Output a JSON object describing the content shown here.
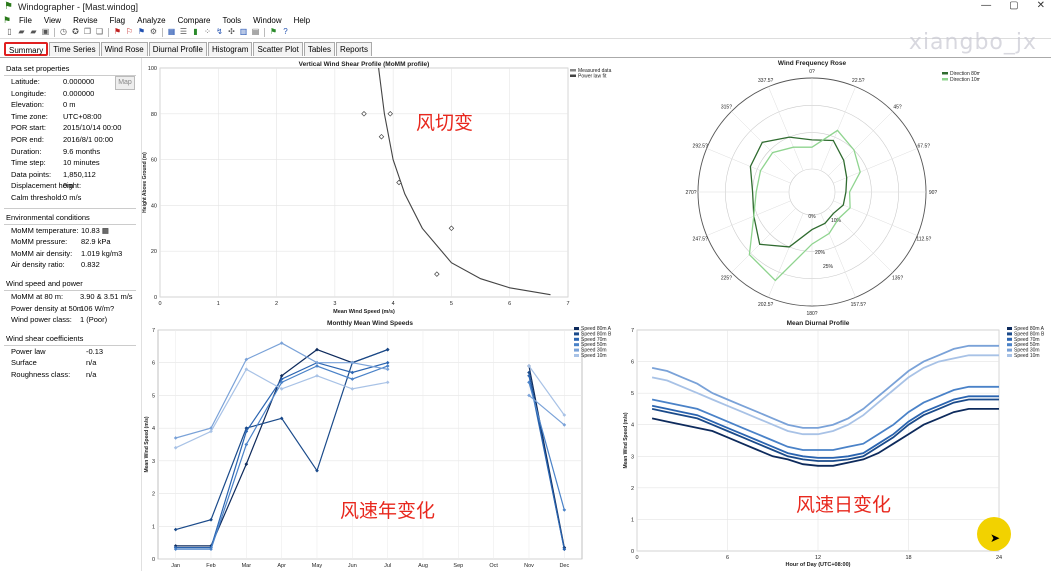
{
  "window": {
    "title": "Windographer - [Mast.windog]",
    "min": "—",
    "max": "▢",
    "close": "✕"
  },
  "menu": [
    "File",
    "View",
    "Revise",
    "Flag",
    "Analyze",
    "Compare",
    "Tools",
    "Window",
    "Help"
  ],
  "watermark": "xiangbo_jx",
  "tabs": [
    "Summary",
    "Time Series",
    "Wind Rose",
    "Diurnal Profile",
    "Histogram",
    "Scatter Plot",
    "Tables",
    "Reports"
  ],
  "map_label": "Map",
  "sidebar": {
    "dataset_title": "Data set properties",
    "dataset": [
      {
        "k": "Latitude:",
        "v": "0.000000"
      },
      {
        "k": "Longitude:",
        "v": "0.000000"
      },
      {
        "k": "Elevation:",
        "v": "0 m"
      },
      {
        "k": "Time zone:",
        "v": "UTC+08:00"
      },
      {
        "k": "POR start:",
        "v": "2015/10/14 00:00"
      },
      {
        "k": "POR end:",
        "v": "2016/8/1 00:00"
      },
      {
        "k": "Duration:",
        "v": "9.6 months"
      },
      {
        "k": "Time step:",
        "v": "10 minutes"
      },
      {
        "k": "Data points:",
        "v": "1,850,112"
      },
      {
        "k": "Displacement height:",
        "v": "0m"
      },
      {
        "k": "Calm threshold:",
        "v": "0 m/s"
      }
    ],
    "env_title": "Environmental conditions",
    "env": [
      {
        "k": "MoMM temperature:",
        "v": "10.83 ▦"
      },
      {
        "k": "MoMM pressure:",
        "v": "82.9 kPa"
      },
      {
        "k": "MoMM air density:",
        "v": "1.019 kg/m3"
      },
      {
        "k": "Air density ratio:",
        "v": "0.832"
      }
    ],
    "wind_title": "Wind speed and power",
    "wind": [
      {
        "k": "MoMM at 80 m:",
        "v": "3.90 & 3.51 m/s"
      },
      {
        "k": "Power density at 50m",
        "v": "106 W/m?"
      },
      {
        "k": "Wind power class:",
        "v": "1  (Poor)"
      }
    ],
    "shear_title": "Wind shear coefficients",
    "shear": [
      {
        "k": "Power law",
        "v": "-0.13"
      },
      {
        "k": "Surface",
        "v": "n/a"
      },
      {
        "k": "Roughness class:",
        "v": "n/a"
      }
    ]
  },
  "annotations": {
    "shear": "风切变",
    "monthly": "风速年变化",
    "diurnal": "风速日变化"
  },
  "chart_data": [
    {
      "type": "scatter",
      "title": "Vertical Wind Shear Profile (MoMM profile)",
      "xlabel": "Mean Wind Speed (m/s)",
      "ylabel": "Height Above Ground (m)",
      "xlim": [
        0,
        7
      ],
      "ylim": [
        0,
        100
      ],
      "xticks": [
        "0",
        "1",
        "2",
        "3",
        "4",
        "5",
        "6",
        "7"
      ],
      "yticks": [
        "0",
        "20",
        "40",
        "60",
        "80",
        "100"
      ],
      "legend": [
        "Measured data",
        "Power law fit"
      ],
      "legend_position": "top-right",
      "measured": [
        {
          "x": 3.5,
          "y": 80
        },
        {
          "x": 3.95,
          "y": 80
        },
        {
          "x": 3.8,
          "y": 70
        },
        {
          "x": 4.1,
          "y": 50
        },
        {
          "x": 5.0,
          "y": 30
        },
        {
          "x": 4.75,
          "y": 10
        }
      ],
      "fit": [
        {
          "x": 3.75,
          "y": 100
        },
        {
          "x": 3.85,
          "y": 80
        },
        {
          "x": 4.0,
          "y": 60
        },
        {
          "x": 4.2,
          "y": 45
        },
        {
          "x": 4.5,
          "y": 30
        },
        {
          "x": 5.0,
          "y": 15
        },
        {
          "x": 5.5,
          "y": 8
        },
        {
          "x": 6.0,
          "y": 4
        },
        {
          "x": 6.7,
          "y": 1
        }
      ],
      "colors": {
        "measured": "#444444",
        "fit": "#444444"
      }
    },
    {
      "type": "polar",
      "title": "Wind Frequency Rose",
      "directions": [
        "0?",
        "22.5?",
        "45?",
        "67.5?",
        "90?",
        "112.5?",
        "135?",
        "157.5?",
        "180?",
        "202.5?",
        "225?",
        "247.5?",
        "270?",
        "292.5?",
        "315?",
        "337.5?"
      ],
      "ring_labels": [
        "0%",
        "10%",
        "20%",
        "25%"
      ],
      "legend": [
        "Direction 80m",
        "Direction 10m"
      ],
      "legend_position": "top-right",
      "series": [
        {
          "name": "Direction 80m",
          "color": "#2f6b2f",
          "values": [
            8,
            9,
            6,
            4,
            3,
            3,
            2,
            3,
            4,
            10,
            14,
            11,
            10,
            12,
            13,
            10
          ]
        },
        {
          "name": "Direction 10m",
          "color": "#8fd48f",
          "values": [
            6,
            12,
            10,
            8,
            4,
            5,
            4,
            6,
            8,
            20,
            18,
            11,
            9,
            9,
            9,
            7
          ]
        }
      ]
    },
    {
      "type": "line",
      "title": "Monthly Mean Wind Speeds",
      "ylabel": "Mean Wind Speed (m/s)",
      "categories": [
        "Jan",
        "Feb",
        "Mar",
        "Apr",
        "May",
        "Jun",
        "Jul",
        "Aug",
        "Sep",
        "Oct",
        "Nov",
        "Dec"
      ],
      "ylim": [
        0,
        7
      ],
      "yticks": [
        "0",
        "1",
        "2",
        "3",
        "4",
        "5",
        "6",
        "7"
      ],
      "legend_position": "top-right",
      "series": [
        {
          "name": "Speed 80m A",
          "color": "#0d2a5c",
          "values": [
            0.4,
            0.4,
            2.9,
            5.6,
            6.4,
            6.0,
            6.4,
            null,
            null,
            null,
            5.9,
            0.35
          ]
        },
        {
          "name": "Speed 80m B",
          "color": "#1a4a8a",
          "values": [
            0.9,
            1.2,
            4.0,
            4.3,
            2.7,
            6.0,
            6.4,
            null,
            null,
            null,
            5.7,
            0.3
          ]
        },
        {
          "name": "Speed 70m",
          "color": "#2a64b0",
          "values": [
            0.35,
            0.35,
            3.9,
            5.5,
            6.0,
            5.7,
            6.0,
            null,
            null,
            null,
            5.6,
            0.3
          ]
        },
        {
          "name": "Speed 50m",
          "color": "#4a82c8",
          "values": [
            0.3,
            0.3,
            3.5,
            5.4,
            5.9,
            5.5,
            5.9,
            null,
            null,
            null,
            5.4,
            1.5
          ]
        },
        {
          "name": "Speed 30m",
          "color": "#7aa2d8",
          "values": [
            3.7,
            4.0,
            6.1,
            6.6,
            6.0,
            6.0,
            5.8,
            null,
            null,
            null,
            5.0,
            4.1
          ]
        },
        {
          "name": "Speed 10m",
          "color": "#a8c2e6",
          "values": [
            3.4,
            3.9,
            5.8,
            5.2,
            5.6,
            5.2,
            5.4,
            null,
            null,
            null,
            5.9,
            4.4
          ]
        }
      ]
    },
    {
      "type": "line",
      "title": "Mean Diurnal Profile",
      "xlabel": "Hour of Day (UTC+08:00)",
      "ylabel": "Mean Wind Speed (m/s)",
      "xlim": [
        0,
        24
      ],
      "ylim": [
        0,
        7
      ],
      "xticks": [
        "0",
        "6",
        "12",
        "18",
        "24"
      ],
      "yticks": [
        "0",
        "1",
        "2",
        "3",
        "4",
        "5",
        "6",
        "7"
      ],
      "legend_position": "top-right",
      "x": [
        1,
        2,
        3,
        4,
        5,
        6,
        7,
        8,
        9,
        10,
        11,
        12,
        13,
        14,
        15,
        16,
        17,
        18,
        19,
        20,
        21,
        22,
        23,
        24
      ],
      "series": [
        {
          "name": "Speed 80m A",
          "color": "#0d2a5c",
          "values": [
            4.2,
            4.1,
            4.0,
            3.9,
            3.8,
            3.6,
            3.4,
            3.2,
            3.0,
            2.9,
            2.75,
            2.7,
            2.7,
            2.8,
            2.9,
            3.1,
            3.4,
            3.7,
            4.0,
            4.2,
            4.4,
            4.5,
            4.5,
            4.5
          ]
        },
        {
          "name": "Speed 80m B",
          "color": "#1a4a8a",
          "values": [
            4.5,
            4.4,
            4.3,
            4.2,
            4.0,
            3.8,
            3.6,
            3.4,
            3.2,
            3.0,
            2.9,
            2.85,
            2.85,
            2.9,
            3.0,
            3.3,
            3.6,
            4.0,
            4.3,
            4.5,
            4.7,
            4.8,
            4.8,
            4.8
          ]
        },
        {
          "name": "Speed 70m",
          "color": "#2a64b0",
          "values": [
            4.6,
            4.5,
            4.4,
            4.3,
            4.1,
            3.9,
            3.7,
            3.5,
            3.3,
            3.1,
            3.0,
            2.95,
            2.95,
            3.0,
            3.1,
            3.4,
            3.7,
            4.1,
            4.4,
            4.6,
            4.8,
            4.9,
            4.9,
            4.9
          ]
        },
        {
          "name": "Speed 50m",
          "color": "#4a82c8",
          "values": [
            4.8,
            4.7,
            4.6,
            4.5,
            4.3,
            4.1,
            3.9,
            3.7,
            3.5,
            3.3,
            3.2,
            3.2,
            3.2,
            3.3,
            3.4,
            3.7,
            4.0,
            4.4,
            4.7,
            4.9,
            5.1,
            5.2,
            5.2,
            5.2
          ]
        },
        {
          "name": "Speed 30m",
          "color": "#7aa2d8",
          "values": [
            5.8,
            5.7,
            5.5,
            5.3,
            5.0,
            4.8,
            4.6,
            4.4,
            4.2,
            4.0,
            3.9,
            3.9,
            4.0,
            4.2,
            4.5,
            4.9,
            5.3,
            5.7,
            6.0,
            6.2,
            6.4,
            6.5,
            6.5,
            6.5
          ]
        },
        {
          "name": "Speed 10m",
          "color": "#a8c2e6",
          "values": [
            5.5,
            5.4,
            5.2,
            5.0,
            4.8,
            4.6,
            4.4,
            4.2,
            4.0,
            3.8,
            3.7,
            3.7,
            3.8,
            4.0,
            4.3,
            4.7,
            5.1,
            5.5,
            5.8,
            6.0,
            6.1,
            6.2,
            6.2,
            6.2
          ]
        }
      ]
    }
  ]
}
